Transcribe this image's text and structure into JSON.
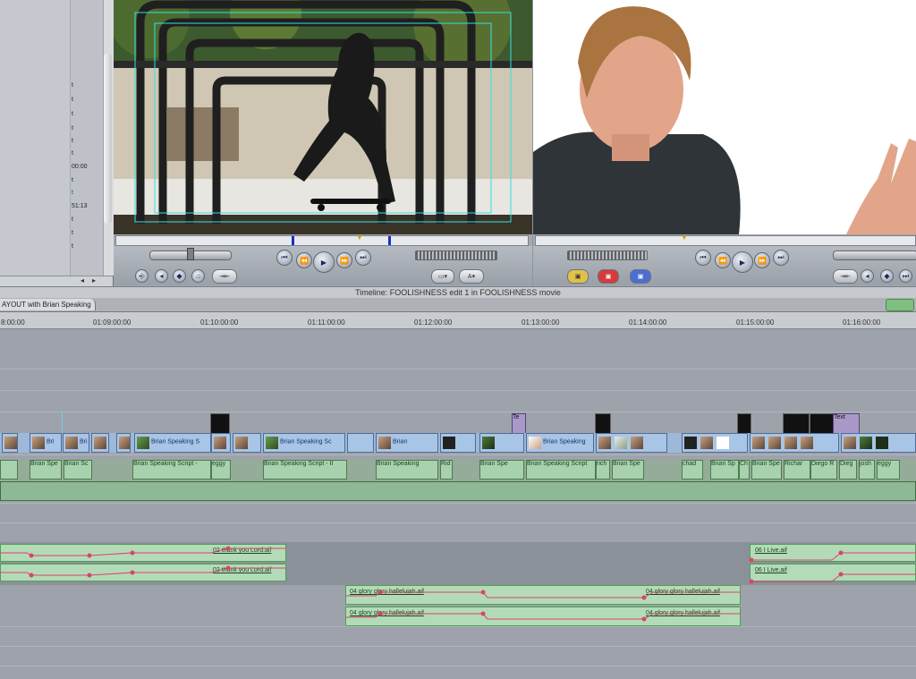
{
  "browser": {
    "cells": [
      "t",
      "t",
      "t",
      "t",
      "t",
      "t",
      "00:00",
      "t",
      "t",
      "51:13",
      "t",
      "t",
      "t"
    ]
  },
  "timeline": {
    "title": "Timeline: FOOLISHNESS edit 1 in FOOLISHNESS movie",
    "tab_label": "AYOUT with Brian Speaking",
    "timecodes": [
      "8:00:00",
      "01:09:00:00",
      "01:10:00:00",
      "01:11:00:00",
      "01:12:00:00",
      "01:13:00:00",
      "01:14:00:00",
      "01:15:00:00",
      "01:16:00:00"
    ]
  },
  "video_clips": [
    {
      "label": "Bri"
    },
    {
      "label": "Bri"
    },
    {
      "label": "Brian Speaking S"
    },
    {
      "label": "Brian Speaking Sc"
    },
    {
      "label": "Brian"
    },
    {
      "label": "Brian Speaking"
    }
  ],
  "text_clips": [
    {
      "label": "Te"
    },
    {
      "label": "Text"
    }
  ],
  "audio_clips": [
    {
      "label": "Brian Spe"
    },
    {
      "label": "Brian Sc"
    },
    {
      "label": "Brian Speaking Script -"
    },
    {
      "label": "eggy"
    },
    {
      "label": "Brian Speaking Script - II"
    },
    {
      "label": "Brian Speaking"
    },
    {
      "label": "Rid"
    },
    {
      "label": "Brian Spe"
    },
    {
      "label": "Brian Speaking Script"
    },
    {
      "label": "rich"
    },
    {
      "label": "Brian Spe"
    },
    {
      "label": "chad"
    },
    {
      "label": "Brian Sp"
    },
    {
      "label": "Ch"
    },
    {
      "label": "Brian Spe"
    },
    {
      "label": "Richar"
    },
    {
      "label": "Diego R"
    },
    {
      "label": "Dieg"
    },
    {
      "label": "josh"
    },
    {
      "label": "eggy"
    }
  ],
  "music_clips": [
    {
      "label": "02 thank you Lord.aif"
    },
    {
      "label": "02 thank you Lord.aif"
    },
    {
      "label": "06 I Live.aif"
    },
    {
      "label": "06 I Live.aif"
    },
    {
      "label": "04 glory glory hallelujah.aif"
    },
    {
      "label": "04 glory glory hallelujah.aif"
    },
    {
      "label": "04 glory glory hallelujah.aif"
    },
    {
      "label": "04 glory glory hallelujah.aif"
    }
  ]
}
